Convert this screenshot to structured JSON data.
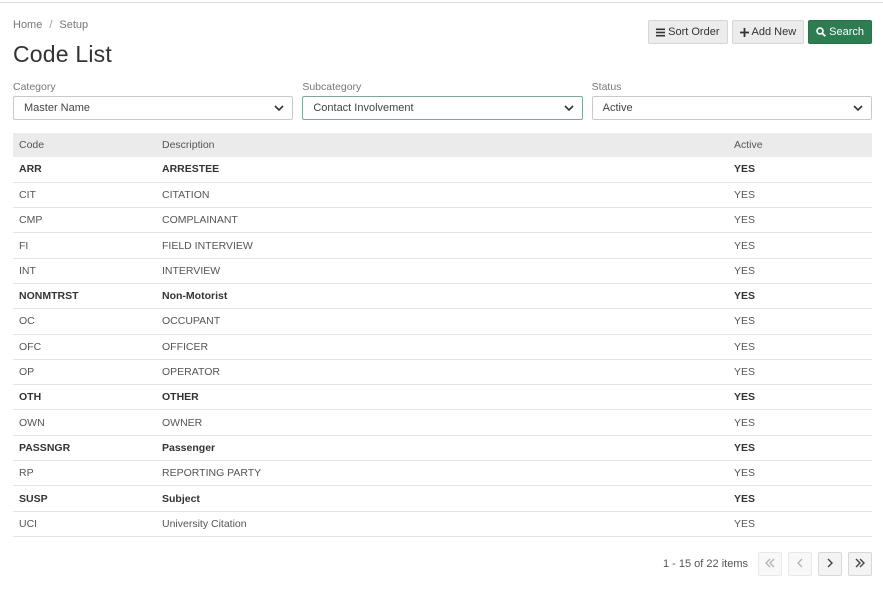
{
  "breadcrumb": {
    "home": "Home",
    "separator": "/",
    "current": "Setup"
  },
  "page_title": "Code List",
  "toolbar": {
    "sort_label": "Sort Order",
    "add_label": "Add New",
    "search_label": "Search"
  },
  "filters": {
    "category": {
      "label": "Category",
      "value": "Master Name"
    },
    "subcategory": {
      "label": "Subcategory",
      "value": "Contact Involvement"
    },
    "status": {
      "label": "Status",
      "value": "Active"
    }
  },
  "table": {
    "headers": {
      "code": "Code",
      "description": "Description",
      "active": "Active"
    },
    "rows": [
      {
        "code": "ARR",
        "description": "ARRESTEE",
        "active": "YES",
        "bold": true
      },
      {
        "code": "CIT",
        "description": "CITATION",
        "active": "YES",
        "bold": false
      },
      {
        "code": "CMP",
        "description": "COMPLAINANT",
        "active": "YES",
        "bold": false
      },
      {
        "code": "FI",
        "description": "FIELD INTERVIEW",
        "active": "YES",
        "bold": false
      },
      {
        "code": "INT",
        "description": "INTERVIEW",
        "active": "YES",
        "bold": false
      },
      {
        "code": "NONMTRST",
        "description": "Non-Motorist",
        "active": "YES",
        "bold": true
      },
      {
        "code": "OC",
        "description": "OCCUPANT",
        "active": "YES",
        "bold": false
      },
      {
        "code": "OFC",
        "description": "OFFICER",
        "active": "YES",
        "bold": false
      },
      {
        "code": "OP",
        "description": "OPERATOR",
        "active": "YES",
        "bold": false
      },
      {
        "code": "OTH",
        "description": "OTHER",
        "active": "YES",
        "bold": true
      },
      {
        "code": "OWN",
        "description": "OWNER",
        "active": "YES",
        "bold": false
      },
      {
        "code": "PASSNGR",
        "description": "Passenger",
        "active": "YES",
        "bold": true
      },
      {
        "code": "RP",
        "description": "REPORTING PARTY",
        "active": "YES",
        "bold": false
      },
      {
        "code": "SUSP",
        "description": "Subject",
        "active": "YES",
        "bold": true
      },
      {
        "code": "UCI",
        "description": "University Citation",
        "active": "YES",
        "bold": false
      }
    ]
  },
  "pager": {
    "info": "1 - 15 of 22 items"
  },
  "colors": {
    "primary": "#2e7d52",
    "header_bg": "#ebebeb"
  }
}
